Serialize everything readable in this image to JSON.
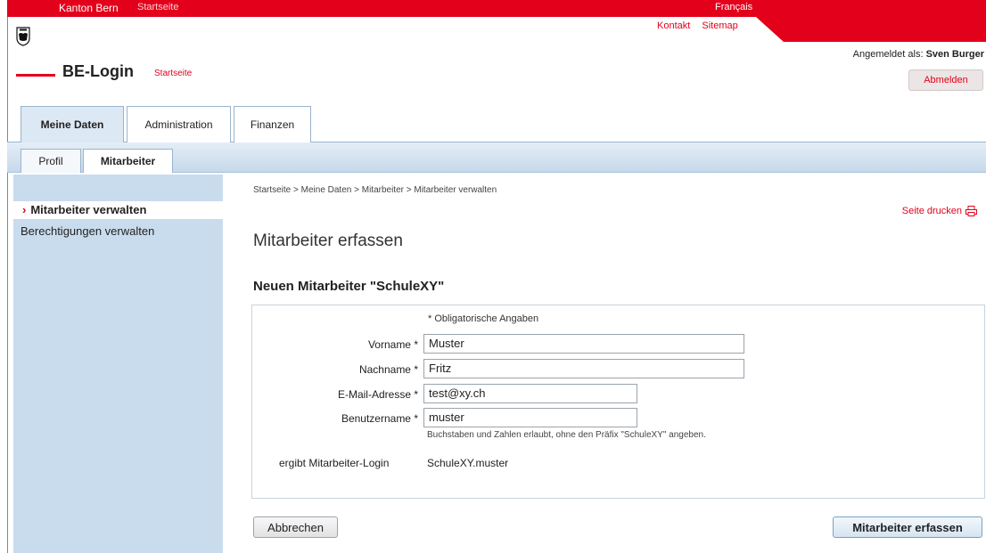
{
  "topbar": {
    "canton": "Kanton Bern",
    "home": "Startseite",
    "language": "Français"
  },
  "header": {
    "brand": "BE-Login",
    "brand_home": "Startseite",
    "links": [
      "Kontakt",
      "Sitemap"
    ],
    "logged_in_label": "Angemeldet als:",
    "logged_in_user": "Sven Burger",
    "logout": "Abmelden"
  },
  "main_tabs": [
    {
      "label": "Meine Daten",
      "active": true
    },
    {
      "label": "Administration",
      "active": false
    },
    {
      "label": "Finanzen",
      "active": false
    }
  ],
  "sub_tabs": [
    {
      "label": "Profil",
      "active": false
    },
    {
      "label": "Mitarbeiter",
      "active": true
    }
  ],
  "sidebar": {
    "items": [
      {
        "label": "Mitarbeiter verwalten",
        "active": true
      },
      {
        "label": "Berechtigungen verwalten",
        "active": false
      }
    ]
  },
  "breadcrumb": "Startseite > Meine Daten > Mitarbeiter > Mitarbeiter verwalten",
  "print_label": "Seite drucken",
  "page_title": "Mitarbeiter erfassen",
  "section_title": "Neuen Mitarbeiter \"SchuleXY\"",
  "form": {
    "required_note": "* Obligatorische Angaben",
    "fields": [
      {
        "label": "Vorname *",
        "value": "Muster"
      },
      {
        "label": "Nachname *",
        "value": "Fritz"
      },
      {
        "label": "E-Mail-Adresse *",
        "value": "test@xy.ch"
      },
      {
        "label": "Benutzername *",
        "value": "muster"
      }
    ],
    "username_hint": "Buchstaben und Zahlen erlaubt, ohne den Präfix \"SchuleXY\" angeben.",
    "result_label": "ergibt Mitarbeiter-Login",
    "result_value": "SchuleXY.muster"
  },
  "buttons": {
    "cancel": "Abbrechen",
    "submit": "Mitarbeiter erfassen"
  },
  "colors": {
    "accent": "#e3001b",
    "nav_blue": "#c9dced"
  }
}
